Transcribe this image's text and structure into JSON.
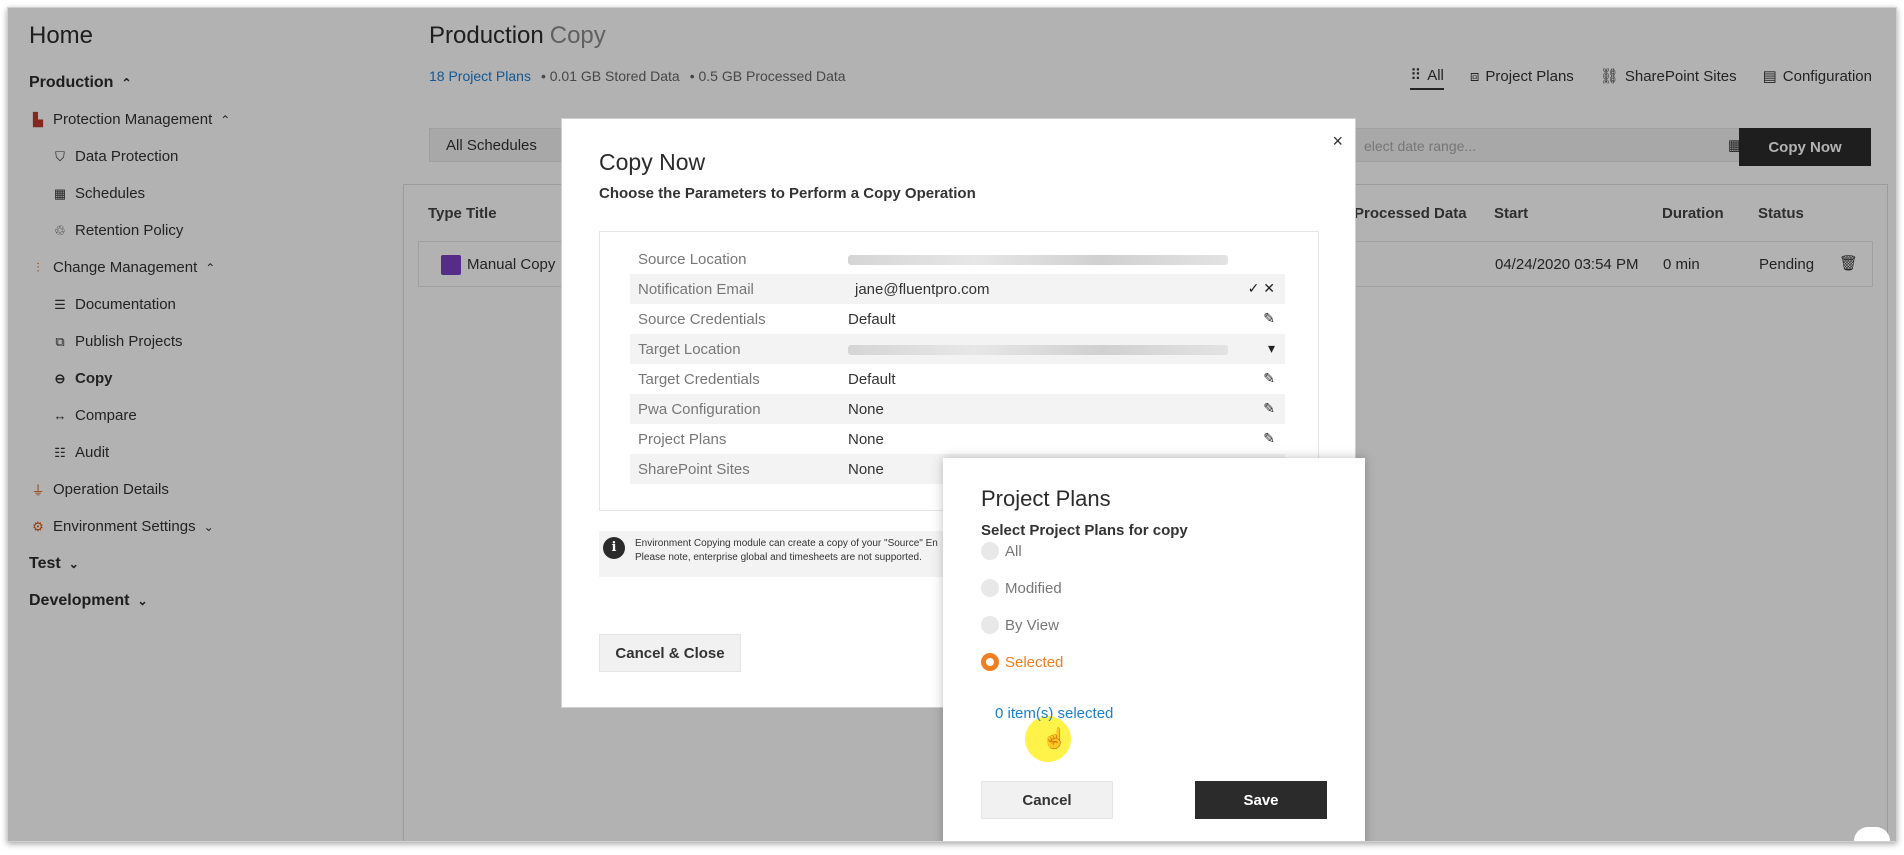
{
  "sidebar": {
    "title": "Home",
    "items": [
      {
        "label": "Production",
        "icon": "chevron-up-icon",
        "level": "group"
      },
      {
        "label": "Protection Management",
        "icon": "protection-chart-icon",
        "level": "lvl1"
      },
      {
        "label": "Data Protection",
        "icon": "shield-icon",
        "level": "lvl2"
      },
      {
        "label": "Schedules",
        "icon": "calendar-icon",
        "level": "lvl2"
      },
      {
        "label": "Retention Policy",
        "icon": "retention-icon",
        "level": "lvl2"
      },
      {
        "label": "Change Management",
        "icon": "sliders-icon",
        "level": "lvl1"
      },
      {
        "label": "Documentation",
        "icon": "document-icon",
        "level": "lvl2"
      },
      {
        "label": "Publish Projects",
        "icon": "publish-icon",
        "level": "lvl2"
      },
      {
        "label": "Copy",
        "icon": "copy-icon",
        "level": "lvl2"
      },
      {
        "label": "Compare",
        "icon": "compare-arrows-icon",
        "level": "lvl2"
      },
      {
        "label": "Audit",
        "icon": "audit-icon",
        "level": "lvl2"
      },
      {
        "label": "Operation Details",
        "icon": "operation-icon",
        "level": "lvl1"
      },
      {
        "label": "Environment Settings",
        "icon": "gear-icon",
        "level": "lvl1"
      },
      {
        "label": "Test",
        "icon": "chevron-down-icon",
        "level": "group"
      },
      {
        "label": "Development",
        "icon": "chevron-down-icon",
        "level": "group"
      }
    ]
  },
  "header": {
    "title": "Production",
    "subtitle": "Copy",
    "stats": {
      "plans": "18 Project Plans",
      "stored": "• 0.01 GB Stored Data",
      "processed": "• 0.5 GB Processed Data"
    },
    "tabs": [
      "All",
      "Project Plans",
      "SharePoint Sites",
      "Configuration"
    ]
  },
  "toolbar": {
    "schedules": "All Schedules",
    "date_placeholder": "elect date range...",
    "copy_now": "Copy Now"
  },
  "grid": {
    "columns": [
      "Type",
      "Title",
      "Processed Data",
      "Start",
      "Duration",
      "Status"
    ],
    "row": {
      "title": "Manual Copy",
      "start": "04/24/2020 03:54 PM",
      "duration": "0 min",
      "status": "Pending"
    }
  },
  "dialog": {
    "close": "×",
    "title": "Copy Now",
    "subtitle": "Choose the Parameters to Perform a Copy Operation",
    "params": [
      {
        "label": "Source Location",
        "value": "",
        "blurred": true
      },
      {
        "label": "Notification Email",
        "value": "jane@fluentpro.com"
      },
      {
        "label": "Source Credentials",
        "value": "Default"
      },
      {
        "label": "Target Location",
        "value": "",
        "blurred": true
      },
      {
        "label": "Target Credentials",
        "value": "Default"
      },
      {
        "label": "Pwa Configuration",
        "value": "None"
      },
      {
        "label": "Project Plans",
        "value": "None"
      },
      {
        "label": "SharePoint Sites",
        "value": "None"
      }
    ],
    "info_line1": "Environment Copying module can create a copy of your \"Source\" En",
    "info_line2": "Please note, enterprise global and timesheets are not supported.",
    "cancel_close": "Cancel & Close"
  },
  "project_plans_popup": {
    "title": "Project Plans",
    "subtitle": "Select Project Plans for copy",
    "options": [
      "All",
      "Modified",
      "By View",
      "Selected"
    ],
    "selected_option": "Selected",
    "items_selected": "0 item(s) selected",
    "cancel": "Cancel",
    "save": "Save",
    "accent_color": "#f07f22"
  }
}
